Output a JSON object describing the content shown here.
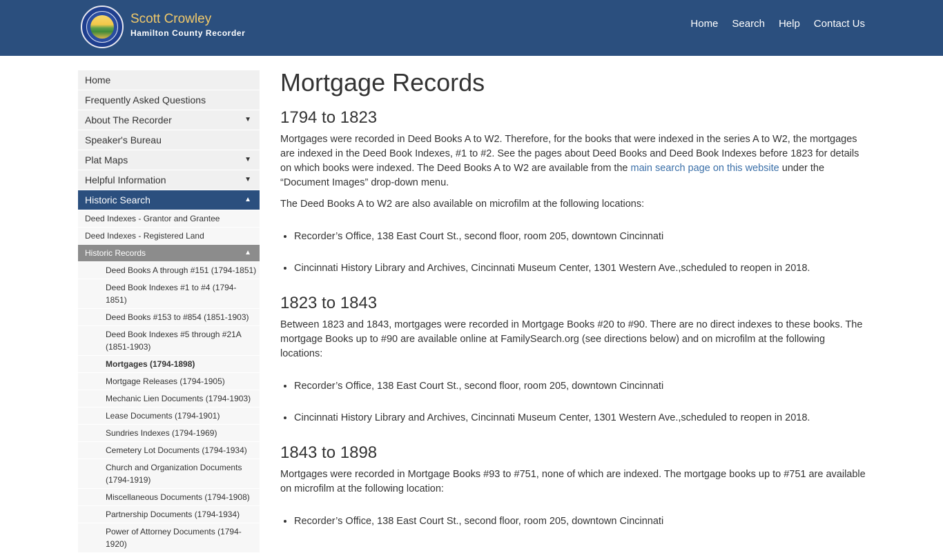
{
  "header": {
    "seal_icon": "county-seal-logo",
    "name": "Scott Crowley",
    "subtitle": "Hamilton County Recorder",
    "nav": [
      "Home",
      "Search",
      "Help",
      "Contact Us"
    ]
  },
  "sidebar": {
    "items": [
      {
        "label": "Home",
        "caret": ""
      },
      {
        "label": "Frequently Asked Questions",
        "caret": ""
      },
      {
        "label": "About The Recorder",
        "caret": "▼"
      },
      {
        "label": "Speaker's Bureau",
        "caret": ""
      },
      {
        "label": "Plat Maps",
        "caret": "▼"
      },
      {
        "label": "Helpful Information",
        "caret": "▼"
      },
      {
        "label": "Historic Search",
        "caret": "▲"
      }
    ],
    "sub_items": [
      "Deed Indexes - Grantor and Grantee",
      "Deed Indexes - Registered Land"
    ],
    "historic_records": {
      "label": "Historic Records",
      "caret": "▲"
    },
    "records": [
      "Deed Books A through #151 (1794-1851)",
      "Deed Book Indexes #1 to #4 (1794-1851)",
      "Deed Books #153 to #854 (1851-1903)",
      "Deed Book Indexes #5 through #21A (1851-1903)",
      "Mortgages (1794-1898)",
      "Mortgage Releases (1794-1905)",
      "Mechanic Lien Documents (1794-1903)",
      "Lease Documents (1794-1901)",
      "Sundries Indexes (1794-1969)",
      "Cemetery Lot Documents (1794-1934)",
      "Church and Organization Documents (1794-1919)",
      "Miscellaneous Documents (1794-1908)",
      "Partnership Documents (1794-1934)",
      "Power of Attorney Documents (1794-1920)"
    ]
  },
  "content": {
    "title": "Mortgage Records",
    "s1": {
      "heading": "1794 to 1823",
      "p1_before": "Mortgages were recorded in Deed Books A to W2. Therefore, for the books that were indexed in the series A to W2, the mortgages are indexed in the Deed Book Indexes, #1 to #2. See the pages about Deed Books and Deed Book Indexes before 1823 for details on which books were indexed. The Deed Books A to W2 are available from the ",
      "p1_link": "main search page on this website",
      "p1_after": " under the “Document Images” drop-down menu.",
      "p2": "The Deed Books A to W2 are also available on microfilm at the following locations:",
      "list": [
        "Recorder’s Office, 138 East Court St., second floor, room 205, downtown Cincinnati",
        "Cincinnati History Library and Archives, Cincinnati Museum Center, 1301 Western Ave.,scheduled to reopen in 2018."
      ]
    },
    "s2": {
      "heading": "1823 to 1843",
      "p1": "Between 1823 and 1843, mortgages were recorded in Mortgage Books #20 to #90. There are no direct indexes to these books. The mortgage Books up to #90 are available online at FamilySearch.org (see directions below) and on microfilm at the following locations:",
      "list": [
        "Recorder’s Office, 138 East Court St., second floor, room 205, downtown Cincinnati",
        "Cincinnati History Library and Archives, Cincinnati Museum Center, 1301 Western Ave.,scheduled to reopen in 2018."
      ]
    },
    "s3": {
      "heading": "1843 to 1898",
      "p1": "Mortgages were recorded in Mortgage Books #93 to #751, none of which are indexed. The mortgage books up to #751 are available on microfilm at the following location:",
      "list": [
        "Recorder’s Office, 138 East Court St., second floor, room 205, downtown Cincinnati"
      ]
    }
  },
  "colors": {
    "header_bg": "#2b4f7e",
    "brand_name": "#f1c96a",
    "link": "#3a6fa8",
    "sidebar_bg": "#f0f0f0",
    "sidebar_active": "#2b4f7e",
    "sub_active": "#8c8c8c"
  }
}
